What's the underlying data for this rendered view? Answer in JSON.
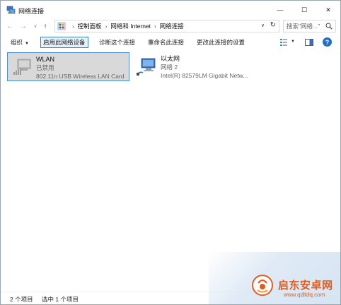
{
  "window": {
    "title": "网络连接",
    "minimize": "—",
    "maximize": "☐",
    "close": "✕"
  },
  "nav": {
    "back": "←",
    "forward": "→",
    "history": "∨",
    "up": "↑"
  },
  "address": {
    "crumbs": [
      "控制面板",
      "网络和 Internet",
      "网络连接"
    ],
    "separator": "›",
    "dropdown": "∨",
    "refresh": "↻"
  },
  "search": {
    "placeholder": "搜索\"网络...\""
  },
  "commands": {
    "organize": "组织",
    "organize_caret": "▼",
    "disable": "启用此网络设备",
    "diagnose": "诊断这个连接",
    "rename": "重命名此连接",
    "change_settings": "更改此连接的设置",
    "view_caret": "▼",
    "help": "?"
  },
  "connections": [
    {
      "name": "WLAN",
      "status": "已禁用",
      "device": "802.11n USB Wireless LAN Card"
    },
    {
      "name": "以太网",
      "status": "网络 2",
      "device": "Intel(R) 82579LM Gigabit Netw..."
    }
  ],
  "status_bar": {
    "count": "2 个项目",
    "selected": "选中 1 个项目"
  },
  "watermark": {
    "name": "启东安卓网",
    "url": "www.qdltdq.com"
  },
  "colors": {
    "accent": "#1f6fc5",
    "selection_border": "#4a90d9",
    "watermark": "#e25c1e"
  }
}
